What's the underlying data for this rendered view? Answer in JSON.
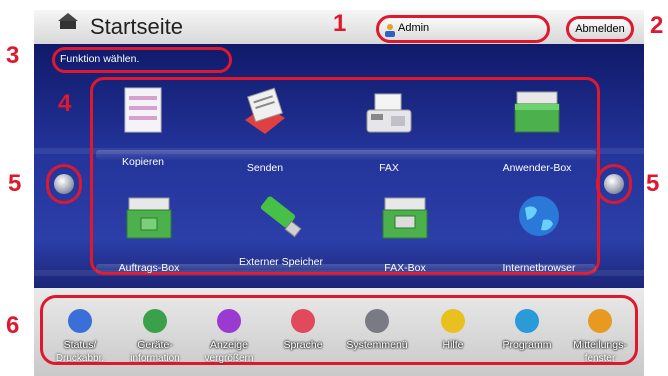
{
  "header": {
    "title": "Startseite",
    "user_label": "Admin",
    "logout_label": "Abmelden"
  },
  "function_prompt": "Funktion wählen.",
  "tiles": [
    {
      "label": "Kopieren",
      "icon": "copier-icon"
    },
    {
      "label": "Senden",
      "icon": "send-icon"
    },
    {
      "label": "FAX",
      "icon": "fax-icon"
    },
    {
      "label": "Anwender-Box",
      "icon": "user-box-icon"
    },
    {
      "label": "Auftrags-Box",
      "icon": "job-box-icon"
    },
    {
      "label": "Externer Speicher",
      "icon": "usb-memory-icon"
    },
    {
      "label": "FAX-Box",
      "icon": "fax-box-icon"
    },
    {
      "label": "Internetbrowser",
      "icon": "globe-icon"
    }
  ],
  "bottom": [
    {
      "line1": "Status/",
      "line2": "Druckabbr.",
      "color": "#3a6fd8"
    },
    {
      "line1": "Geräte-",
      "line2": "information",
      "color": "#3aa04a"
    },
    {
      "line1": "Anzeige",
      "line2": "vergrößern",
      "color": "#9a3ad0"
    },
    {
      "line1": "Sprache",
      "line2": "",
      "color": "#e04a5a"
    },
    {
      "line1": "Systemmenü",
      "line2": "",
      "color": "#7a7a84"
    },
    {
      "line1": "Hilfe",
      "line2": "",
      "color": "#e8c020"
    },
    {
      "line1": "Programm",
      "line2": "",
      "color": "#2a9ad8"
    },
    {
      "line1": "Mitteilungs-",
      "line2": "fenster",
      "color": "#e89a20"
    }
  ],
  "callouts": {
    "n1": "1",
    "n2": "2",
    "n3": "3",
    "n4": "4",
    "n5a": "5",
    "n5b": "5",
    "n6": "6"
  },
  "colors": {
    "callout": "#e0182d",
    "panel": "#23349a"
  }
}
